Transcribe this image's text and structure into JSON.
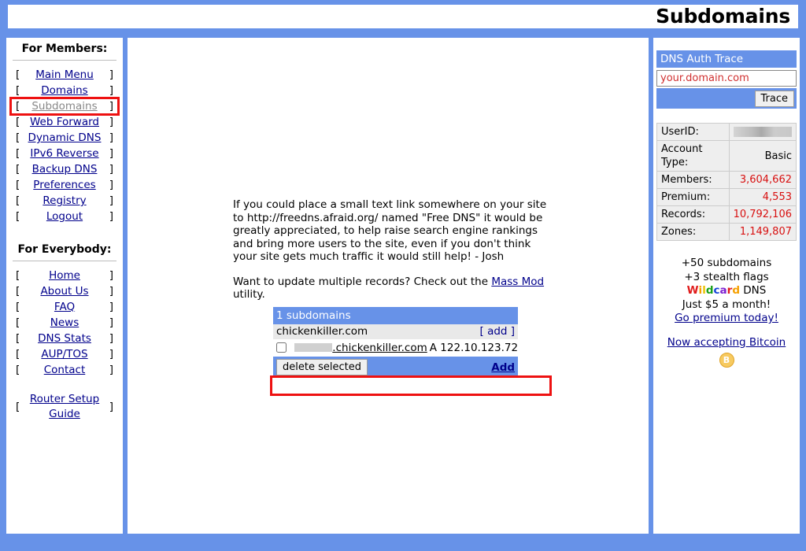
{
  "header": {
    "title": "Subdomains"
  },
  "sidebar": {
    "members_title": "For Members:",
    "everybody_title": "For Everybody:",
    "bracket_left": "[",
    "bracket_right": "]",
    "members_items": [
      {
        "label": "Main Menu",
        "state": "link"
      },
      {
        "label": "Domains",
        "state": "link"
      },
      {
        "label": "Subdomains",
        "state": "visited-highlighted"
      },
      {
        "label": "Web Forward",
        "state": "link"
      },
      {
        "label": "Dynamic DNS",
        "state": "link"
      },
      {
        "label": "IPv6 Reverse",
        "state": "link"
      },
      {
        "label": "Backup DNS",
        "state": "link"
      },
      {
        "label": "Preferences",
        "state": "link"
      },
      {
        "label": "Registry",
        "state": "link"
      },
      {
        "label": "Logout",
        "state": "link"
      }
    ],
    "everybody_items": [
      {
        "label": "Home"
      },
      {
        "label": "About Us"
      },
      {
        "label": "FAQ"
      },
      {
        "label": "News"
      },
      {
        "label": "DNS Stats"
      },
      {
        "label": "AUP/TOS"
      },
      {
        "label": "Contact"
      }
    ],
    "router_item": {
      "label": "Router Setup Guide"
    }
  },
  "main": {
    "blurb_paragraph_1": "If you could place a small text link somewhere on your site to http://freedns.afraid.org/ named \"Free DNS\" it would be greatly appreciated, to help raise search engine rankings and bring more users to the site, even if you don't think your site gets much traffic it would still help! - Josh",
    "blurb_paragraph_2_before": "Want to update multiple records? Check out the ",
    "blurb_link": "Mass Mod",
    "blurb_paragraph_2_after": " utility.",
    "table": {
      "header": "1 subdomains",
      "domain_name": "chickenkiller.com",
      "domain_add_label": "[ add ]",
      "record": {
        "subdomain_redacted": "",
        "host_suffix": ".chickenkiller.com",
        "type": "A",
        "destination": "122.10.123.72",
        "checked": false
      },
      "delete_button": "delete selected",
      "add_link": "Add"
    }
  },
  "right": {
    "trace_panel_title": "DNS Auth Trace",
    "trace_input_value": "your.domain.com",
    "trace_input_placeholder": "your.domain.com",
    "trace_button": "Trace",
    "stats": [
      {
        "label": "UserID:",
        "value": "",
        "redacted": true,
        "red": false
      },
      {
        "label": "Account Type:",
        "value": "Basic",
        "redacted": false,
        "red": false
      },
      {
        "label": "Members:",
        "value": "3,604,662",
        "redacted": false,
        "red": true
      },
      {
        "label": "Premium:",
        "value": "4,553",
        "redacted": false,
        "red": true
      },
      {
        "label": "Records:",
        "value": "10,792,106",
        "redacted": false,
        "red": true
      },
      {
        "label": "Zones:",
        "value": "1,149,807",
        "redacted": false,
        "red": true
      }
    ],
    "promo": {
      "line1": "+50 subdomains",
      "line2": "+3 stealth flags",
      "wildcard_word": "Wildcard",
      "wildcard_suffix": " DNS",
      "wildcard_letter_colors": [
        "#e01b1b",
        "#f5a000",
        "#e8c400",
        "#1aa01a",
        "#1342d8",
        "#7d1fd0",
        "#e01b1b",
        "#f5a000"
      ],
      "line4": "Just $5 a month!",
      "premium_link": "Go premium today!",
      "bitcoin_link": "Now accepting Bitcoin",
      "bitcoin_glyph": "B"
    }
  },
  "colors": {
    "frame_blue": "#6792e8",
    "link_blue": "#00008B",
    "stat_red": "#d81010",
    "highlight_red": "#ee1111"
  }
}
